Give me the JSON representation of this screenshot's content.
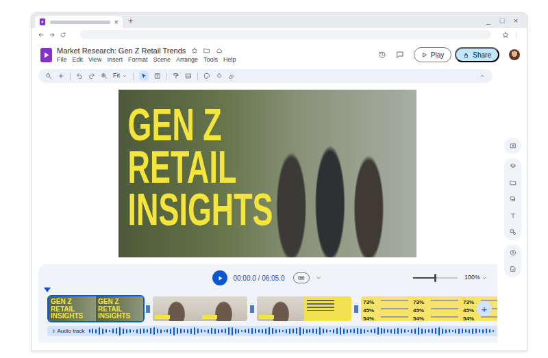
{
  "browser": {
    "tab": {
      "selected": true,
      "close": "×"
    },
    "new_tab": "+",
    "window_controls": [
      "_",
      "□",
      "×"
    ]
  },
  "app": {
    "title": "Market Research: Gen Z Retail Trends",
    "starred": false,
    "menus": [
      "File",
      "Edit",
      "View",
      "Insert",
      "Format",
      "Scene",
      "Arrange",
      "Tools",
      "Help"
    ],
    "play": "Play",
    "share": "Share"
  },
  "toolbar": {
    "zoom": "Fit",
    "select_tool_active": true
  },
  "scene": {
    "title_lines": [
      "GEN Z",
      "RETAIL",
      "INSIGHTS"
    ]
  },
  "timeline": {
    "time": "00:00.0 / 06:05.0",
    "zoom_level": 0.5,
    "zoom": "100%",
    "add": "+",
    "clips": [
      {
        "kind": "title",
        "selected": true,
        "frames": [
          [
            "GEN Z",
            "RETAIL",
            "INSIGHTS"
          ],
          [
            "GEN Z",
            "RETAIL",
            "INSIGHTS"
          ]
        ]
      },
      {
        "kind": "person",
        "selected": false,
        "frames": [
          [],
          []
        ]
      },
      {
        "kind": "mixed",
        "selected": false,
        "frames": [
          [],
          []
        ]
      },
      {
        "kind": "stats",
        "selected": false,
        "frames": [
          [
            "73%",
            "45%",
            "54%"
          ],
          [
            "73%",
            "45%",
            "54%"
          ],
          [
            "73%",
            "45%",
            "54%"
          ]
        ]
      }
    ],
    "audio": {
      "icon": "♪",
      "label": "Audio track",
      "wave": [
        0.3,
        0.5,
        0.4,
        0.8,
        0.6,
        0.3,
        0.2,
        0.5,
        0.7,
        0.9,
        0.6,
        0.4,
        0.3,
        0.2,
        0.4,
        0.6,
        0.5,
        0.3,
        0.7,
        0.8,
        0.5,
        0.4,
        0.2,
        0.3,
        0.6,
        0.9,
        0.7,
        0.5,
        0.3,
        0.4,
        0.6,
        0.8,
        0.5,
        0.3,
        0.2,
        0.4,
        0.7,
        0.6,
        0.4,
        0.3,
        0.5,
        0.8,
        0.9,
        0.6,
        0.4,
        0.2,
        0.3,
        0.5,
        0.7,
        0.5,
        0.3,
        0.4,
        0.6,
        0.8,
        0.7,
        0.4,
        0.3,
        0.2,
        0.4,
        0.6,
        0.5,
        0.7,
        0.9,
        0.6,
        0.4,
        0.3,
        0.5,
        0.6,
        0.8,
        0.5,
        0.3,
        0.2,
        0.4,
        0.7,
        0.8,
        0.6,
        0.4,
        0.3,
        0.5,
        0.7,
        0.6,
        0.4,
        0.2,
        0.3,
        0.5,
        0.8,
        0.7,
        0.5,
        0.3,
        0.4,
        0.6,
        0.7,
        0.5,
        0.3,
        0.2,
        0.4,
        0.6,
        0.8,
        0.6,
        0.4,
        0.3,
        0.5,
        0.7,
        0.9,
        0.6,
        0.4,
        0.3,
        0.2,
        0.4,
        0.6,
        0.5,
        0.3,
        0.4,
        0.6,
        0.5,
        0.3,
        0.4,
        0.5,
        0.3,
        0.2
      ]
    }
  }
}
